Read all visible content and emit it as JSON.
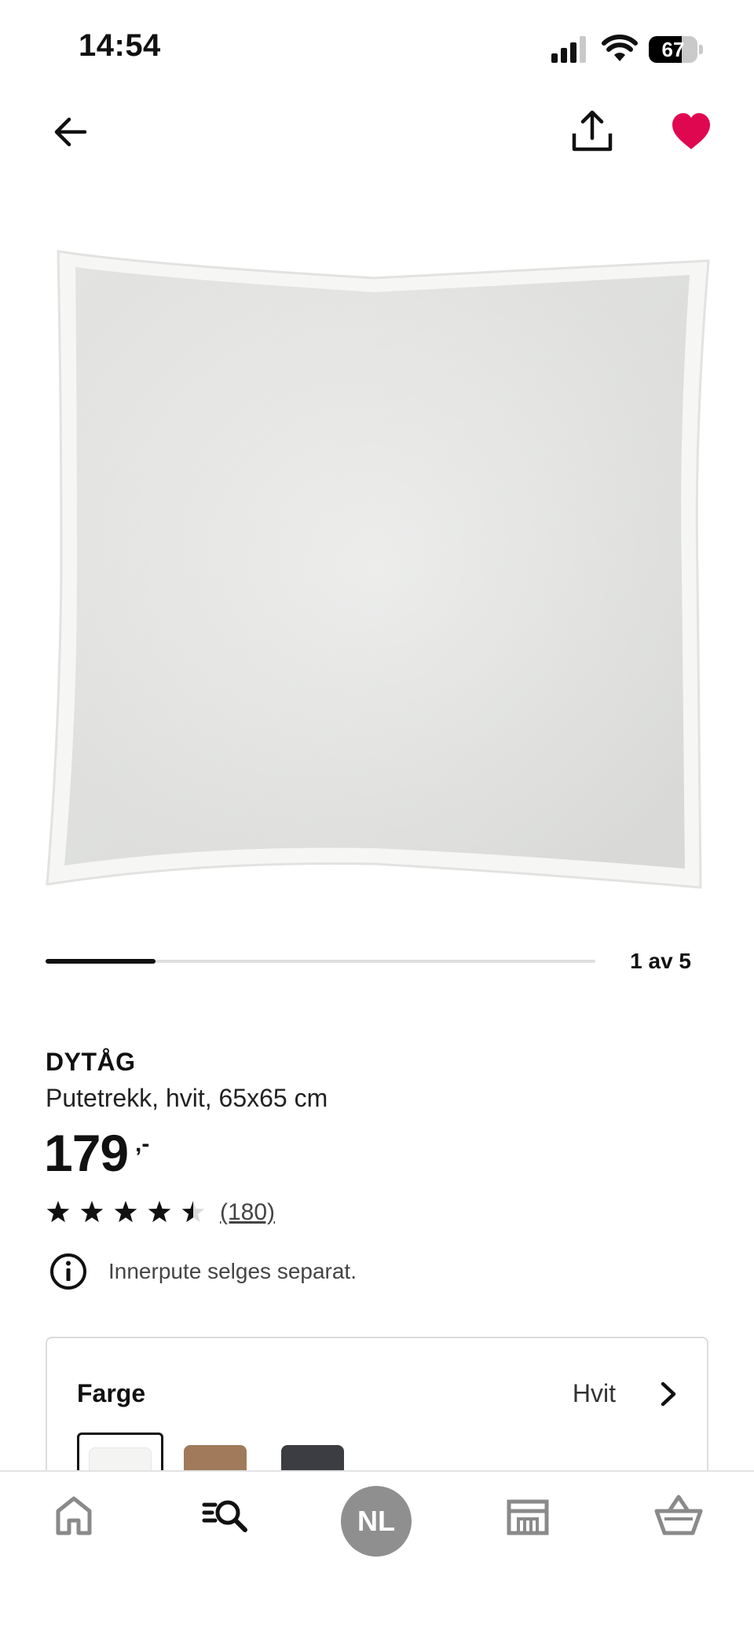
{
  "status_bar": {
    "time": "14:54",
    "battery_level": "67",
    "battery_fraction": 0.67
  },
  "nav": {
    "back_icon": "arrow-left-icon",
    "share_icon": "share-upload-icon",
    "favorite_icon": "heart-filled-icon",
    "favorite_color": "#e00751",
    "favorite_active": true
  },
  "gallery": {
    "counter": "1 av 5",
    "current": 1,
    "total": 5
  },
  "product": {
    "name": "DYTÅG",
    "description": "Putetrekk, hvit, 65x65 cm",
    "price": "179",
    "price_suffix": ",-",
    "rating": 4.5,
    "rating_max": 5,
    "review_count": "(180)",
    "info_text": "Innerpute selges separat."
  },
  "color_selector": {
    "label": "Farge",
    "selected_value": "Hvit",
    "swatches": [
      {
        "color": "#f4f4f2",
        "selected": true
      },
      {
        "color": "#a07a5a",
        "selected": false
      },
      {
        "color": "#3c3d42",
        "selected": false
      }
    ]
  },
  "tab_bar": {
    "home_icon": "home-icon",
    "search_icon": "search-list-icon",
    "profile_initials": "NL",
    "store_icon": "store-icon",
    "cart_icon": "basket-icon"
  }
}
